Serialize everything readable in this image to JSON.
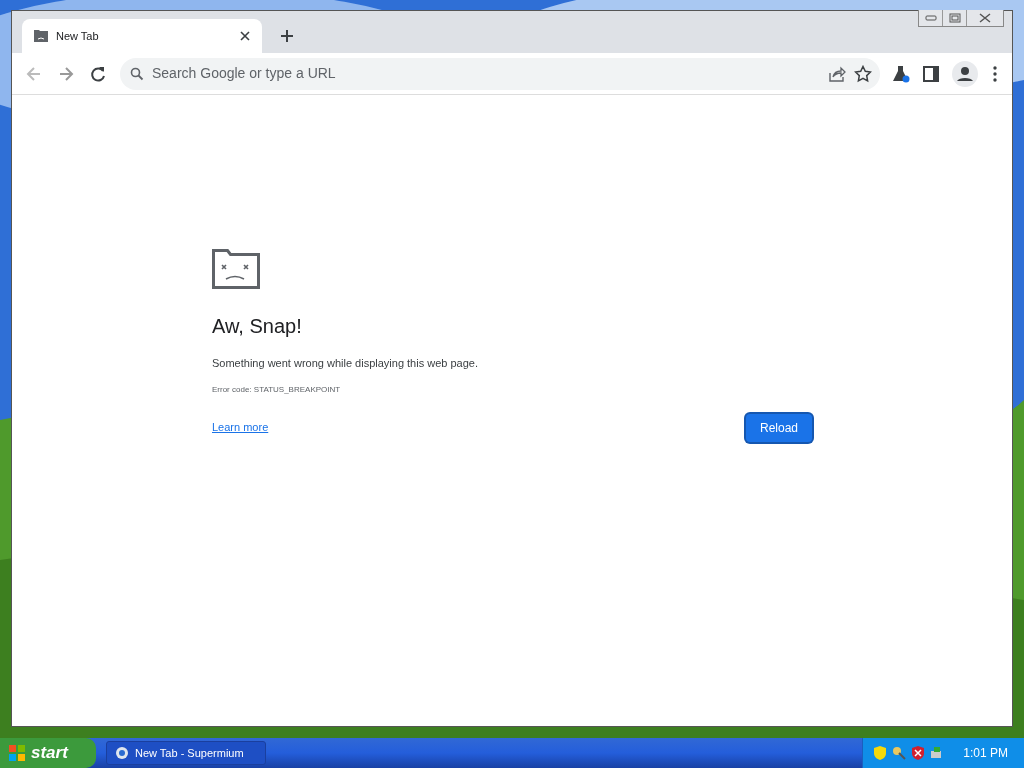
{
  "tabs": [
    {
      "title": "New Tab",
      "selected": true
    }
  ],
  "address_bar": {
    "placeholder": "Search Google or type a URL"
  },
  "error_page": {
    "heading": "Aw, Snap!",
    "message": "Something went wrong while displaying this web page.",
    "error_code": "Error code: STATUS_BREAKPOINT",
    "link": "Learn more",
    "button": "Reload"
  },
  "taskbar": {
    "start": "start",
    "tasks": [
      {
        "title": "New Tab - Supermium"
      }
    ],
    "clock": "1:01 PM"
  }
}
